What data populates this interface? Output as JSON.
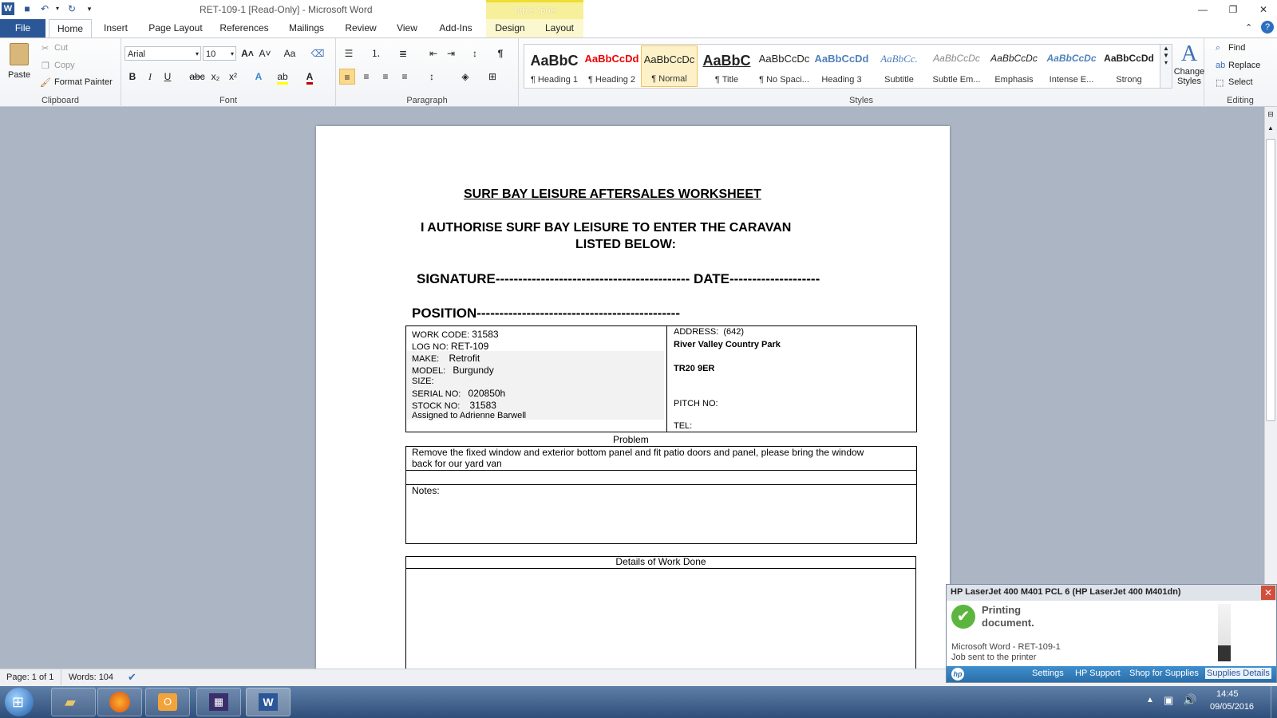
{
  "window": {
    "title": "RET-109-1 [Read-Only]  -  Microsoft Word",
    "context_tab_group": "Table Tools"
  },
  "tabs": [
    "File",
    "Home",
    "Insert",
    "Page Layout",
    "References",
    "Mailings",
    "Review",
    "View",
    "Add-Ins",
    "Design",
    "Layout"
  ],
  "clipboard": {
    "paste": "Paste",
    "cut": "Cut",
    "copy": "Copy",
    "format_painter": "Format Painter",
    "label": "Clipboard"
  },
  "font": {
    "name": "Arial",
    "size": "10",
    "label": "Font",
    "bold": "B",
    "italic": "I",
    "underline": "U",
    "strike": "abc",
    "sub": "x₂",
    "sup": "x²",
    "grow": "A˄",
    "shrink": "A˅",
    "case": "Aa",
    "text_color": "#c00000",
    "highlight_color": "#ffff00"
  },
  "paragraph": {
    "label": "Paragraph"
  },
  "styles": {
    "label": "Styles",
    "items": [
      {
        "sample": "AaBbC",
        "name": "¶ Heading 1"
      },
      {
        "sample": "AaBbCcDd",
        "name": "¶ Heading 2"
      },
      {
        "sample": "AaBbCcDc",
        "name": "¶ Normal"
      },
      {
        "sample": "AaBbC",
        "name": "¶ Title"
      },
      {
        "sample": "AaBbCcDc",
        "name": "¶ No Spaci..."
      },
      {
        "sample": "AaBbCcDd",
        "name": "Heading 3"
      },
      {
        "sample": "AaBbCc.",
        "name": "Subtitle"
      },
      {
        "sample": "AaBbCcDc",
        "name": "Subtle Em..."
      },
      {
        "sample": "AaBbCcDc",
        "name": "Emphasis"
      },
      {
        "sample": "AaBbCcDc",
        "name": "Intense E..."
      },
      {
        "sample": "AaBbCcDd",
        "name": "Strong"
      }
    ],
    "change_styles": "Change Styles"
  },
  "editing": {
    "label": "Editing",
    "find": "Find",
    "replace": "Replace",
    "select": "Select"
  },
  "document": {
    "heading": "SURF BAY LEISURE AFTERSALES WORKSHEET",
    "authorise_1": "I AUTHORISE SURF BAY LEISURE TO ENTER THE CARAVAN",
    "authorise_2": "LISTED BELOW:",
    "signature": "SIGNATURE------------------------------------------- DATE--------------------",
    "position": "POSITION---------------------------------------------",
    "left": {
      "work_code_label": "WORK CODE:",
      "work_code": "31583",
      "log_label": "LOG NO:",
      "log": "RET-109",
      "make_label": "MAKE:",
      "make": "Retrofit",
      "model_label": "MODEL:",
      "model": "Burgundy",
      "size_label": "SIZE:",
      "serial_label": "SERIAL  NO:",
      "serial": "020850h",
      "stock_label": "STOCK NO:",
      "stock": "31583",
      "assigned": "Assigned to Adrienne Barwell"
    },
    "right": {
      "address_label": "ADDRESS:",
      "address_num": "(642)",
      "park": "River Valley Country Park",
      "postcode": "TR20 9ER",
      "pitch_label": "PITCH NO:",
      "tel_label": "TEL:"
    },
    "problem_label": "Problem",
    "problem_text_1": "Remove the fixed window and exterior bottom panel and fit patio doors and panel, please bring the window",
    "problem_text_2": "back for our yard van",
    "notes_label": "Notes:",
    "details_label": "Details of Work Done"
  },
  "status": {
    "page": "Page: 1 of 1",
    "words": "Words: 104"
  },
  "printer_popup": {
    "title": "HP LaserJet 400 M401 PCL 6 (HP LaserJet 400 M401dn)",
    "status_1": "Printing",
    "status_2": "document.",
    "job_1": "Microsoft Word - RET-109-1",
    "job_2": "Job sent to the printer",
    "links": [
      "Settings",
      "HP Support",
      "Shop for Supplies",
      "Supplies Details"
    ]
  },
  "clock": {
    "time": "14:45",
    "date": "09/05/2016"
  }
}
